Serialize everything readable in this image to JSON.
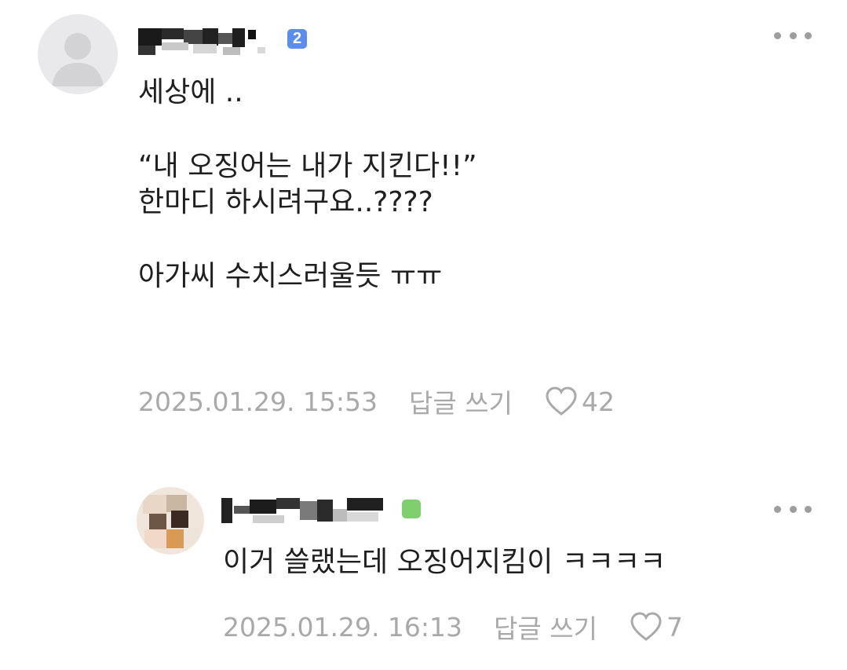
{
  "comments": [
    {
      "level_badge": "2",
      "body": "세상에 ..\n\n“내 오징어는 내가 지킨다!!”\n한마디 하시려구요..????\n\n아가씨 수치스러울듯 ㅠㅠ",
      "date": "2025.01.29. 15:53",
      "reply_label": "답글 쓰기",
      "likes": "42"
    },
    {
      "body": "이거 쓸랬는데 오징어지킴이 ㅋㅋㅋㅋ",
      "date": "2025.01.29. 16:13",
      "reply_label": "답글 쓰기",
      "likes": "7"
    }
  ],
  "colors": {
    "badge_blue": "#5b8def",
    "badge_green": "#7fcf6f",
    "meta_gray": "#a9a9a9",
    "text": "#1f1f1f"
  }
}
